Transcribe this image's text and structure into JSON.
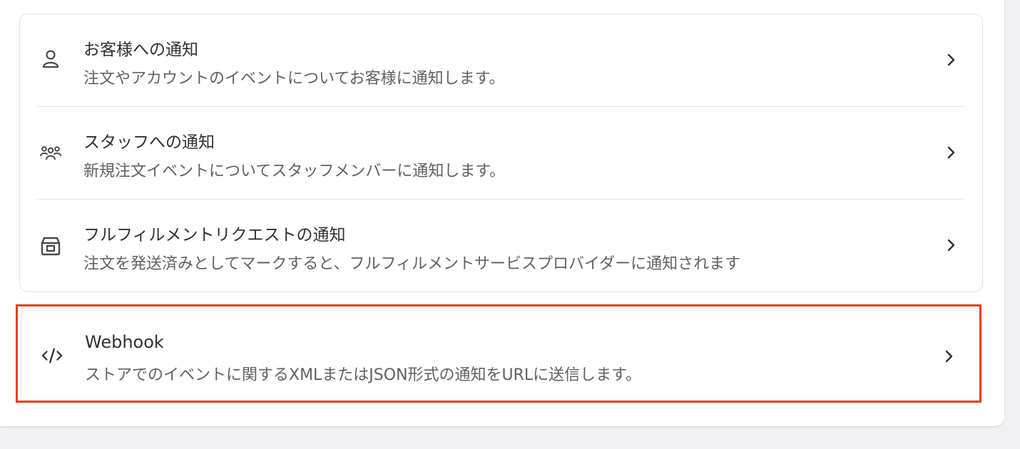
{
  "settings": {
    "items": [
      {
        "title": "お客様への通知",
        "description": "注文やアカウントのイベントについてお客様に通知します。",
        "icon": "person-icon"
      },
      {
        "title": "スタッフへの通知",
        "description": "新規注文イベントについてスタッフメンバーに通知します。",
        "icon": "people-icon"
      },
      {
        "title": "フルフィルメントリクエストの通知",
        "description": "注文を発送済みとしてマークすると、フルフィルメントサービスプロバイダーに通知されます",
        "icon": "store-box-icon"
      }
    ],
    "webhook": {
      "title": "Webhook",
      "description": "ストアでのイベントに関するXMLまたはJSON形式の通知をURLに送信します。",
      "icon": "code-icon"
    }
  },
  "colors": {
    "highlight_border": "#ef3b10",
    "title_text": "#303030",
    "description_text": "#616161",
    "page_background": "#f1f0f3"
  }
}
